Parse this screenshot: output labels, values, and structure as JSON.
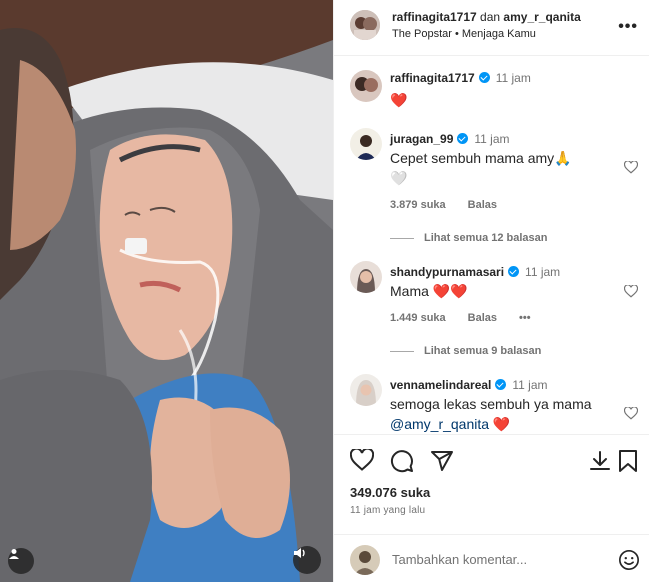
{
  "header": {
    "user1": "raffinagita1717",
    "joiner": "dan",
    "user2": "amy_r_qanita",
    "subtitle": "The Popstar • Menjaga Kamu",
    "more_icon": "more-horizontal-icon"
  },
  "comments": [
    {
      "username": "raffinagita1717",
      "verified": true,
      "time": "11 jam",
      "text": "❤️",
      "show_meta": false
    },
    {
      "username": "juragan_99",
      "verified": true,
      "time": "11 jam",
      "text": "Cepet sembuh mama amy🙏",
      "text2": "🤍",
      "likes": "3.879 suka",
      "reply": "Balas",
      "view_replies": "Lihat semua 12 balasan"
    },
    {
      "username": "shandypurnamasari",
      "verified": true,
      "time": "11 jam",
      "text": "Mama ❤️❤️",
      "likes": "1.449 suka",
      "reply": "Balas",
      "more": "•••",
      "view_replies": "Lihat semua 9 balasan"
    },
    {
      "username": "vennamelindareal",
      "verified": true,
      "time": "11 jam",
      "text_pre": "semoga lekas sembuh ya mama ",
      "mention": "@amy_r_qanita",
      "text_post": " ❤️"
    }
  ],
  "actions": {
    "likes_count": "349.076 suka",
    "posted_time": "11 jam yang lalu"
  },
  "add_comment": {
    "placeholder": "Tambahkan komentar..."
  },
  "colors": {
    "verified": "#0095f6",
    "heart": "#ed4956",
    "secondary_text": "#737373",
    "divider": "#efefef"
  }
}
